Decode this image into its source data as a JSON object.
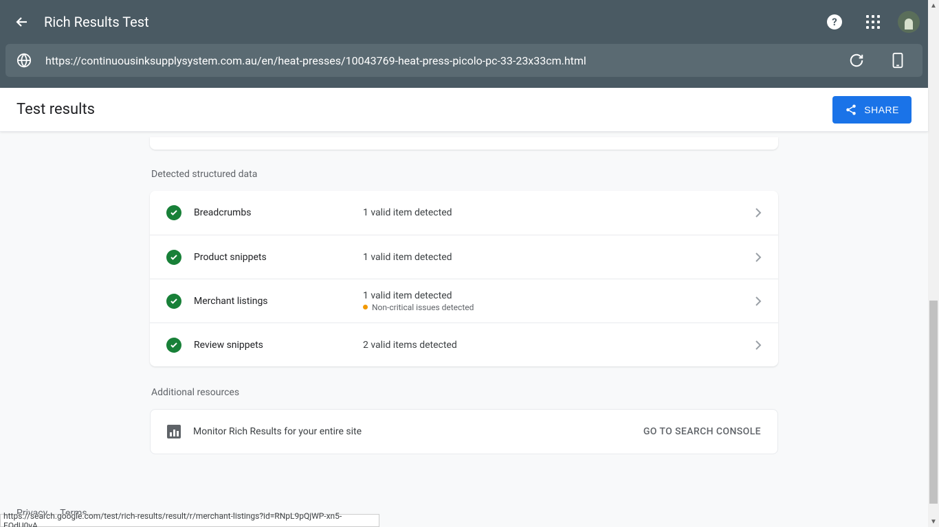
{
  "header": {
    "title": "Rich Results Test",
    "url": "https://continuousinksupplysystem.com.au/en/heat-presses/10043769-heat-press-picolo-pc-33-23x33cm.html"
  },
  "subheader": {
    "title": "Test results",
    "share_label": "SHARE"
  },
  "sections": {
    "structured_label": "Detected structured data",
    "resources_label": "Additional resources"
  },
  "rows": [
    {
      "name": "Breadcrumbs",
      "detail": "1 valid item detected",
      "warning": ""
    },
    {
      "name": "Product snippets",
      "detail": "1 valid item detected",
      "warning": ""
    },
    {
      "name": "Merchant listings",
      "detail": "1 valid item detected",
      "warning": "Non-critical issues detected"
    },
    {
      "name": "Review snippets",
      "detail": "2 valid items detected",
      "warning": ""
    }
  ],
  "resource": {
    "text": "Monitor Rich Results for your entire site",
    "cta": "GO TO SEARCH CONSOLE"
  },
  "footer": {
    "privacy": "Privacy",
    "terms": "Terms"
  },
  "status_url": "https://search.google.com/test/rich-results/result/r/merchant-listings?id=RNpL9pQjWP-xn5-EQdU0yA"
}
